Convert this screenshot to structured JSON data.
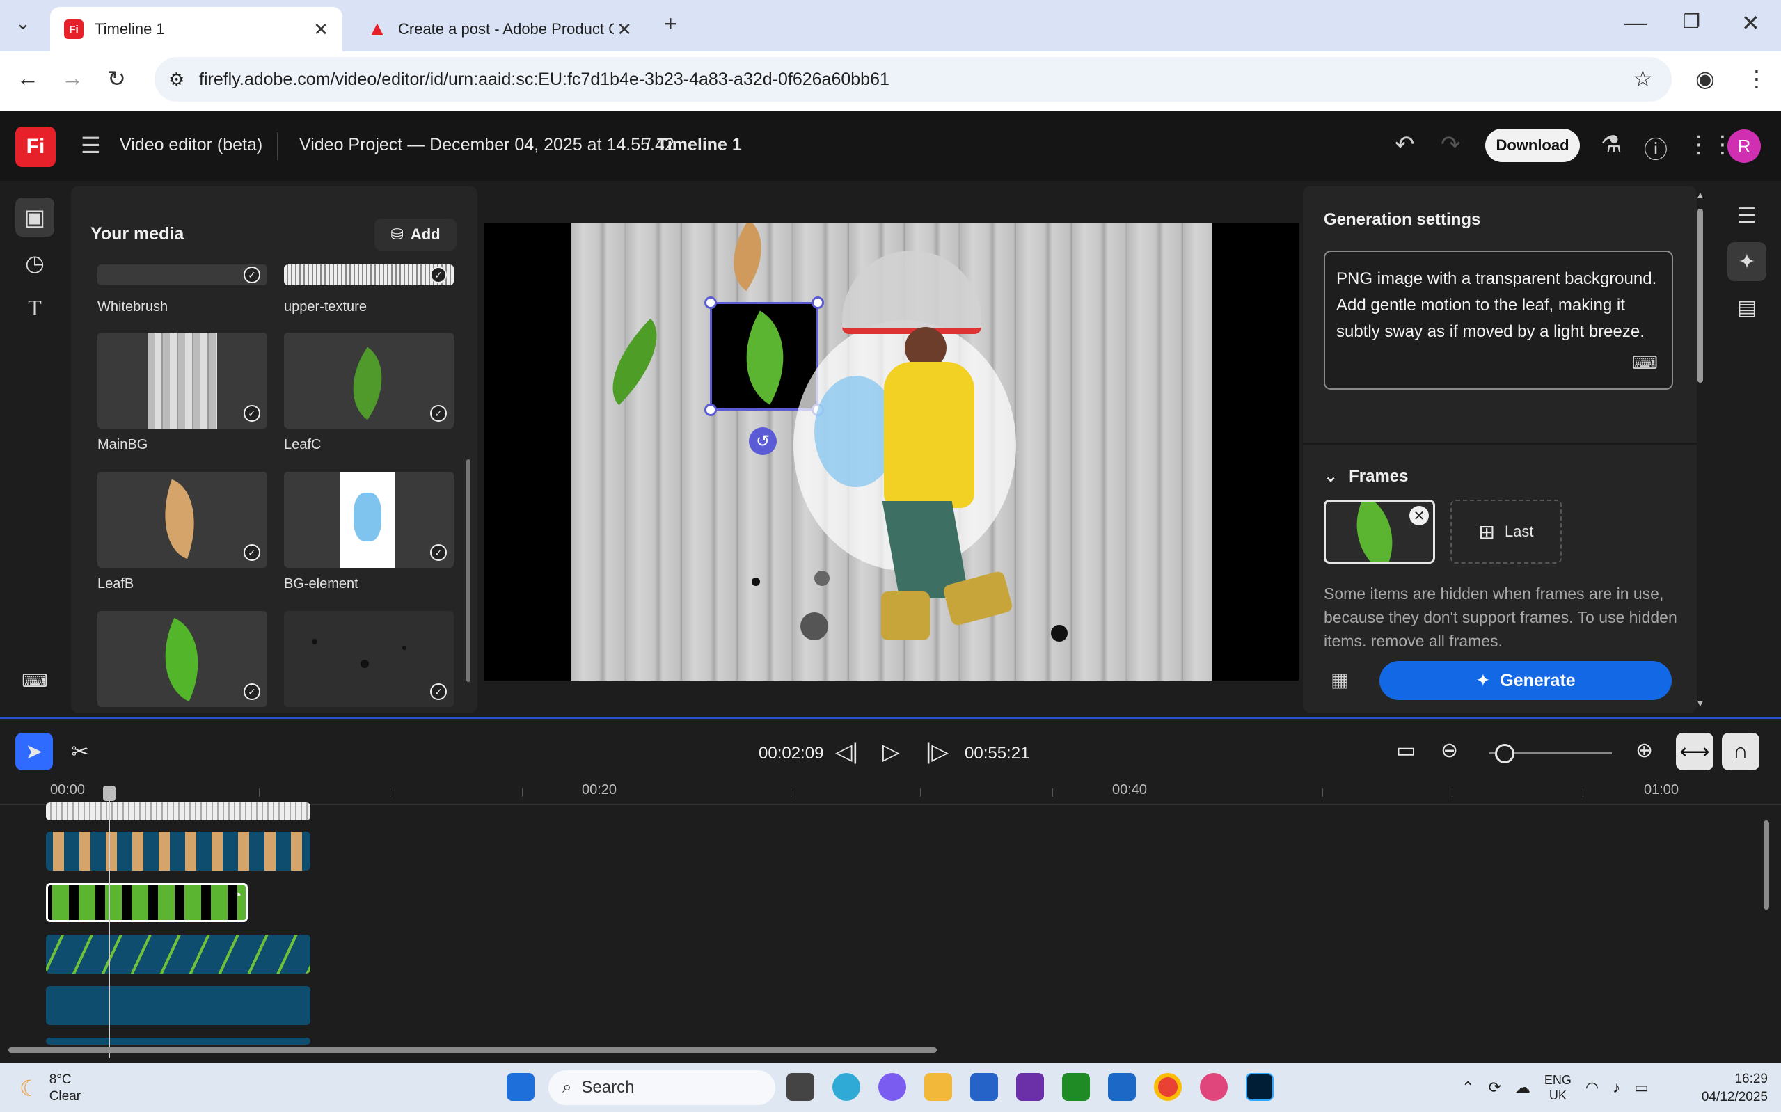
{
  "browser": {
    "tabs": [
      {
        "label": "Timeline 1",
        "favicon": "Fi",
        "active": true
      },
      {
        "label": "Create a post - Adobe Product Cor",
        "active": false
      }
    ],
    "url": "firefly.adobe.com/video/editor/id/urn:aaid:sc:EU:fc7d1b4e-3b23-4a83-a32d-0f626a60bb61"
  },
  "app": {
    "logo": "Fi",
    "name": "Video editor (beta)",
    "project": "Video Project — December 04, 2025 at 14.55.42",
    "separator": "/",
    "timeline_name": "Timeline 1",
    "download_label": "Download",
    "avatar_initial": "R"
  },
  "media": {
    "title": "Your media",
    "add_label": "Add",
    "items": [
      {
        "label": "Whitebrush"
      },
      {
        "label": "upper-texture"
      },
      {
        "label": "MainBG"
      },
      {
        "label": "LeafC"
      },
      {
        "label": "LeafB"
      },
      {
        "label": "BG-element"
      },
      {
        "label": ""
      },
      {
        "label": ""
      }
    ]
  },
  "generation": {
    "title": "Generation settings",
    "prompt": "PNG image with a transparent background. Add gentle motion to the leaf, making it subtly sway as if moved by a light breeze.",
    "frames_label": "Frames",
    "last_label": "Last",
    "frames_note": "Some items are hidden when frames are in use, because they don't support frames. To use hidden items, remove all frames.",
    "generate_label": "Generate"
  },
  "timeline": {
    "current_time": "00:02:09",
    "total_time": "00:55:21",
    "ruler": [
      "00:00",
      "00:20",
      "00:40",
      "01:00"
    ]
  },
  "taskbar": {
    "weather_temp": "8°C",
    "weather_desc": "Clear",
    "search_label": "Search",
    "lang_1": "ENG",
    "lang_2": "UK",
    "time": "16:29",
    "date": "04/12/2025"
  },
  "colors": {
    "accent": "#1368e6",
    "selection": "#5b5bd6",
    "brand": "#e7212a",
    "clip": "#0f4d6e"
  }
}
